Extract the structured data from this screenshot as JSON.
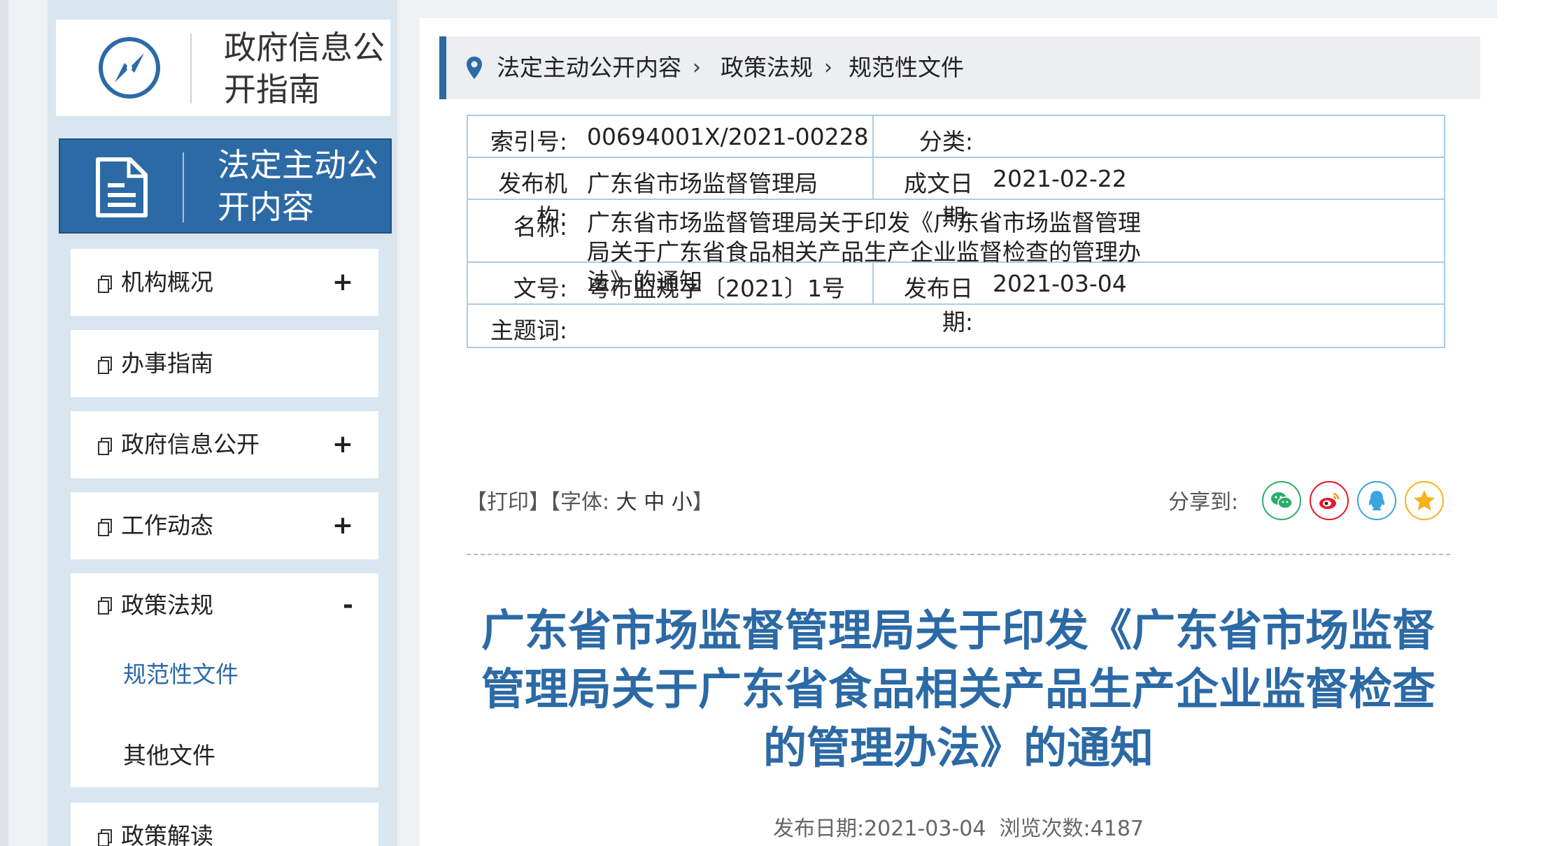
{
  "sidebar": {
    "guide_title": "政府信息公开指南",
    "active_section": "法定主动公开内容",
    "items": [
      {
        "label": "机构概况",
        "toggle": "+"
      },
      {
        "label": "办事指南",
        "toggle": ""
      },
      {
        "label": "政府信息公开",
        "toggle": "+"
      },
      {
        "label": "工作动态",
        "toggle": "+"
      }
    ],
    "expanded": {
      "label": "政策法规",
      "toggle": "-",
      "children": [
        "规范性文件",
        "其他文件"
      ]
    },
    "next_item": {
      "label": "政策解读"
    }
  },
  "breadcrumb": [
    "法定主动公开内容",
    "政策法规",
    "规范性文件"
  ],
  "meta": {
    "index_label": "索引号:",
    "index_value": "00694001X/2021-00228",
    "category_label": "分类:",
    "category_value": "",
    "publisher_label": "发布机构:",
    "publisher_value": "广东省市场监督管理局",
    "created_label": "成文日期:",
    "created_value": "2021-02-22",
    "name_label": "名称:",
    "name_value": "广东省市场监督管理局关于印发《广东省市场监督管理局关于广东省食品相关产品生产企业监督检查的管理办法》的通知",
    "docno_label": "文号:",
    "docno_value": "粤市监规字〔2021〕1号",
    "pubdate_label": "发布日期:",
    "pubdate_value": "2021-03-04",
    "subject_label": "主题词:",
    "subject_value": ""
  },
  "toolbar": {
    "print": "【打印】",
    "font_prefix": "【字体:",
    "font_large": "大",
    "font_medium": "中",
    "font_small": "小",
    "font_suffix": "】",
    "share_label": "分享到:"
  },
  "share": [
    {
      "name": "wechat",
      "color": "#2aae67"
    },
    {
      "name": "weibo",
      "color": "#e6162d"
    },
    {
      "name": "qq",
      "color": "#3aa5e0"
    },
    {
      "name": "qzone",
      "color": "#f6b21b"
    }
  ],
  "article": {
    "title": "广东省市场监督管理局关于印发《广东省市场监督管理局关于广东省食品相关产品生产企业监督检查的管理办法》的通知",
    "pub_label": "发布日期:",
    "pub_date": "2021-03-04",
    "views_label": "浏览次数:",
    "views": "4187"
  }
}
